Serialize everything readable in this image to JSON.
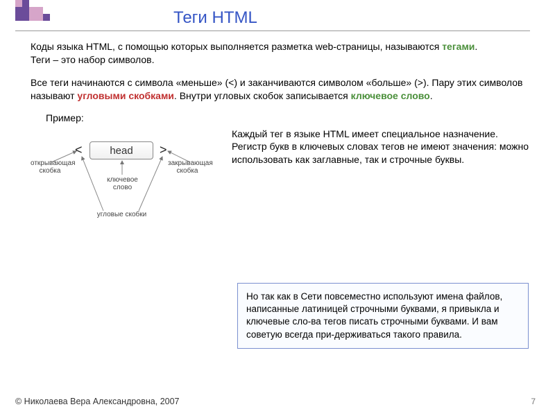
{
  "title": "Теги HTML",
  "para1_a": "Коды языка HTML, с помощью которых выполняется разметка web-страницы, называются ",
  "para1_term": "тегами",
  "para1_b": ".",
  "para1_c": "Теги – это набор символов.",
  "para2_a": "Все теги начинаются с символа «меньше» (<) и заканчиваются символом «больше» (>). Пару этих символов называют ",
  "para2_term1": "угловыми скобками",
  "para2_b": ". Внутри угловых скобок записывается ",
  "para2_term2": "ключевое слово",
  "para2_c": ".",
  "example_label": "Пример:",
  "diagram": {
    "head": "head",
    "lt": "<",
    "gt": ">",
    "labels": {
      "opening": "открывающая скобка",
      "closing": "закрывающая скобка",
      "keyword": "ключевое слово",
      "corner": "угловые скобки"
    }
  },
  "explain": "Каждый тег в языке HTML имеет специальное назначение. Регистр букв в ключевых словах тегов не имеют значения: можно использовать как заглавные, так и строчные буквы.",
  "note": "Но так как в Сети повсеместно используют имена файлов, написанные латиницей строчными буквами, я привыкла и ключевые сло-ва тегов писать строчными буквами. И вам советую всегда при-держиваться такого правила.",
  "footer": "© Николаева Вера Александровна, 2007",
  "pageno": "7"
}
